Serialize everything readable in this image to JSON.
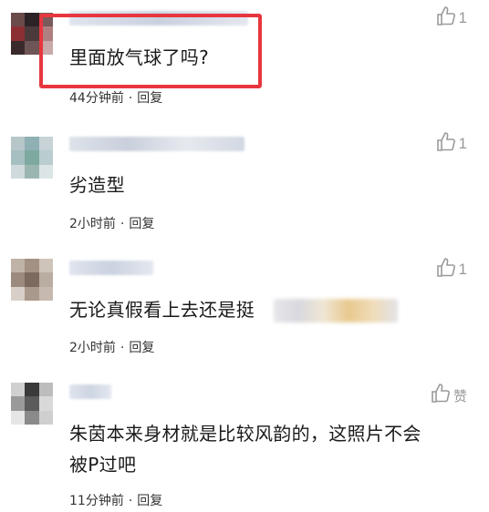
{
  "comments": [
    {
      "text": "里面放气球了吗?",
      "time": "44分钟前",
      "reply": "回复",
      "likes": "1"
    },
    {
      "text": "劣造型",
      "time": "2小时前",
      "reply": "回复",
      "likes": "1"
    },
    {
      "text": "无论真假看上去还是挺",
      "time": "2小时前",
      "reply": "回复",
      "likes": "1"
    },
    {
      "text_line1": "朱茵本来身材就是比较风韵的，这照片不会",
      "text_line2": "被P过吧",
      "time": "11分钟前",
      "reply": "回复",
      "likes": "赞"
    }
  ],
  "separator": "·",
  "colors": {
    "highlight_border": "#e8363e",
    "like_icon": "#9a9a9a"
  },
  "icons": {
    "like": "thumbs-up-icon"
  }
}
